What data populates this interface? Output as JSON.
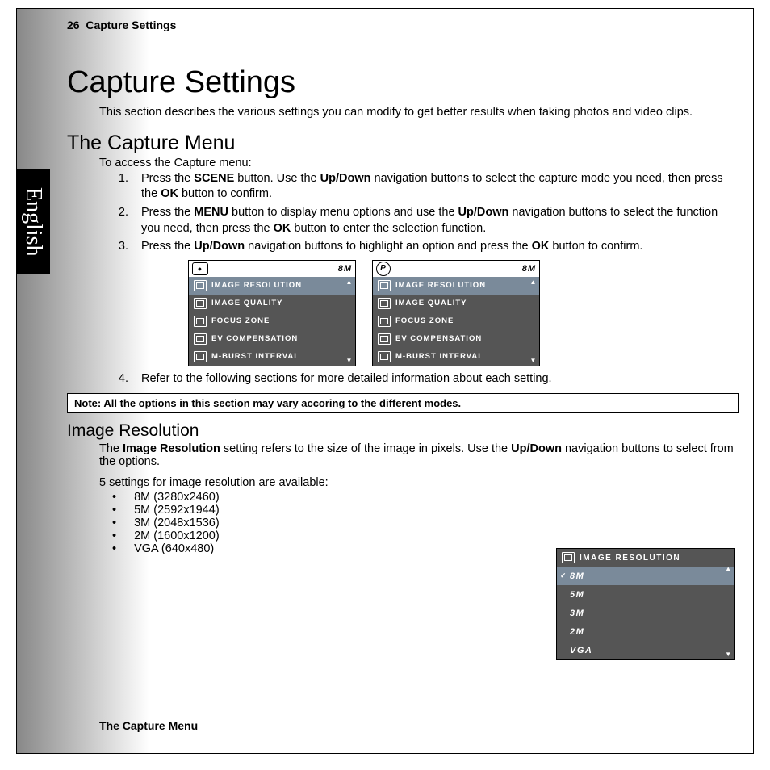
{
  "header": {
    "page_num": "26",
    "section": "Capture Settings"
  },
  "lang": "English",
  "title": "Capture Settings",
  "intro": "This section describes the various settings you can modify to get better results when taking photos and video clips.",
  "h2": "The Capture Menu",
  "access_line": "To access the Capture menu:",
  "steps": {
    "s1a": "Press the ",
    "s1b": "SCENE",
    "s1c": " button. Use the ",
    "s1d": "Up/Down",
    "s1e": " navigation buttons to select the capture mode you need, then press the ",
    "s1f": "OK",
    "s1g": " button to confirm.",
    "s2a": "Press the ",
    "s2b": "MENU",
    "s2c": " button to display menu options and use the ",
    "s2d": "Up/Down",
    "s2e": " navigation buttons to select the function you need, then press the ",
    "s2f": "OK",
    "s2g": " button to enter the selection function.",
    "s3a": "Press the ",
    "s3b": "Up/Down",
    "s3c": " navigation buttons to highlight an option and press the  ",
    "s3d": "OK",
    "s3e": " button to confirm.",
    "s4": "Refer to the following sections for more detailed information about each setting."
  },
  "panel": {
    "badge": "8M",
    "p_label": "P",
    "items": [
      "IMAGE RESOLUTION",
      "IMAGE QUALITY",
      "FOCUS ZONE",
      "EV COMPENSATION",
      "M-BURST INTERVAL"
    ]
  },
  "note": "Note: All the options in this section may vary accoring to the different modes.",
  "h3": "Image Resolution",
  "res_p1a": "The ",
  "res_p1b": "Image Resolution",
  "res_p1c": " setting refers to the size of the image in pixels. Use the ",
  "res_p1d": "Up/Down",
  "res_p1e": " navigation buttons to select from the options.",
  "res_p2": "5 settings for image resolution are available:",
  "res_list": [
    "8M (3280x2460)",
    "5M (2592x1944)",
    "3M (2048x1536)",
    "2M (1600x1200)",
    "VGA (640x480)"
  ],
  "res_panel": {
    "title": "IMAGE RESOLUTION",
    "opts": [
      "8M",
      "5M",
      "3M",
      "2M",
      "VGA"
    ]
  },
  "footer": "The Capture Menu"
}
